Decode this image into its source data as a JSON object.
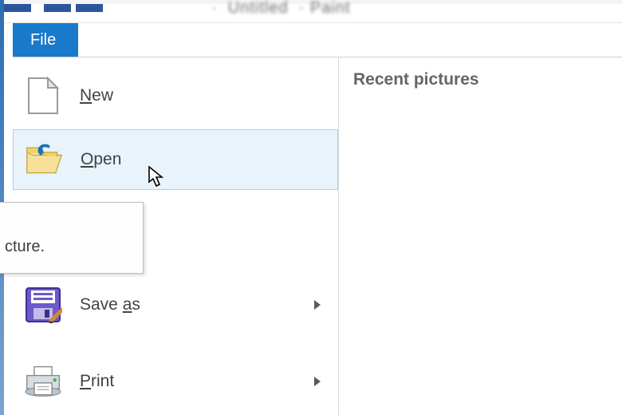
{
  "tab": {
    "file_label": "File"
  },
  "menu": {
    "new": {
      "mnemonic": "N",
      "rest": "ew"
    },
    "open": {
      "mnemonic": "O",
      "rest": "pen"
    },
    "saveas": {
      "pre": "Save ",
      "mnemonic": "a",
      "post": "s"
    },
    "print": {
      "mnemonic": "P",
      "rest": "rint"
    }
  },
  "tooltip_fragment": "cture.",
  "right": {
    "heading": "Recent pictures"
  }
}
